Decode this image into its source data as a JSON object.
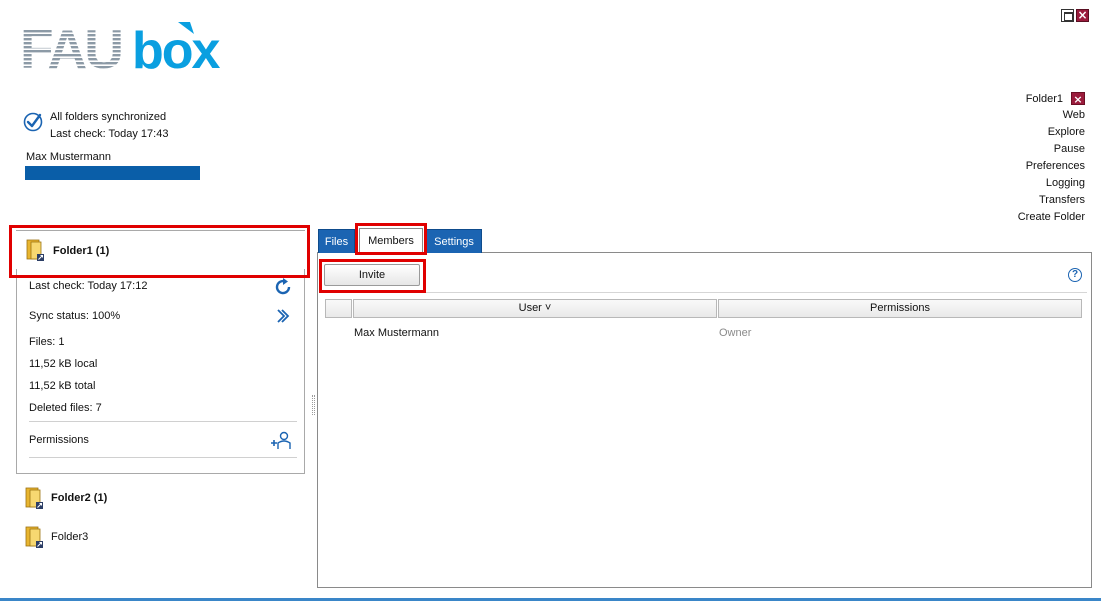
{
  "app": {
    "logo_text_gray": "FAU",
    "logo_text_blue": "box",
    "colors": {
      "brand_blue": "#0a9fe0",
      "logo_gray": "#8c9aa6",
      "accent_blue": "#1b64b2",
      "close_red": "#9b1b3c",
      "highlight_red": "#e00000"
    }
  },
  "window_controls": {
    "maximize_icon": "maximize-icon",
    "close_icon": "close-icon"
  },
  "status": {
    "line1": "All folders synchronized",
    "line2": "Last check: Today 17:43",
    "user": "Max Mustermann"
  },
  "menu": {
    "folder_label": "Folder1",
    "items": [
      "Web",
      "Explore",
      "Pause",
      "Preferences",
      "Logging",
      "Transfers",
      "Create Folder"
    ]
  },
  "folders": [
    {
      "name": "Folder1 (1)",
      "details": {
        "last_check": "Last check: Today 17:12",
        "sync_status": "Sync status: 100%",
        "files": "Files: 1",
        "local": "11,52 kB local",
        "total": "11,52 kB total",
        "deleted": "Deleted files: 7",
        "permissions": "Permissions"
      }
    },
    {
      "name": "Folder2 (1)"
    },
    {
      "name": "Folder3"
    }
  ],
  "tabs": {
    "files": "Files",
    "members": "Members",
    "settings": "Settings",
    "active": "Members"
  },
  "members": {
    "invite_label": "Invite",
    "columns": {
      "user": "User",
      "permissions": "Permissions"
    },
    "sort_glyph": "˅",
    "rows": [
      {
        "user": "Max Mustermann",
        "permission": "Owner"
      }
    ]
  }
}
